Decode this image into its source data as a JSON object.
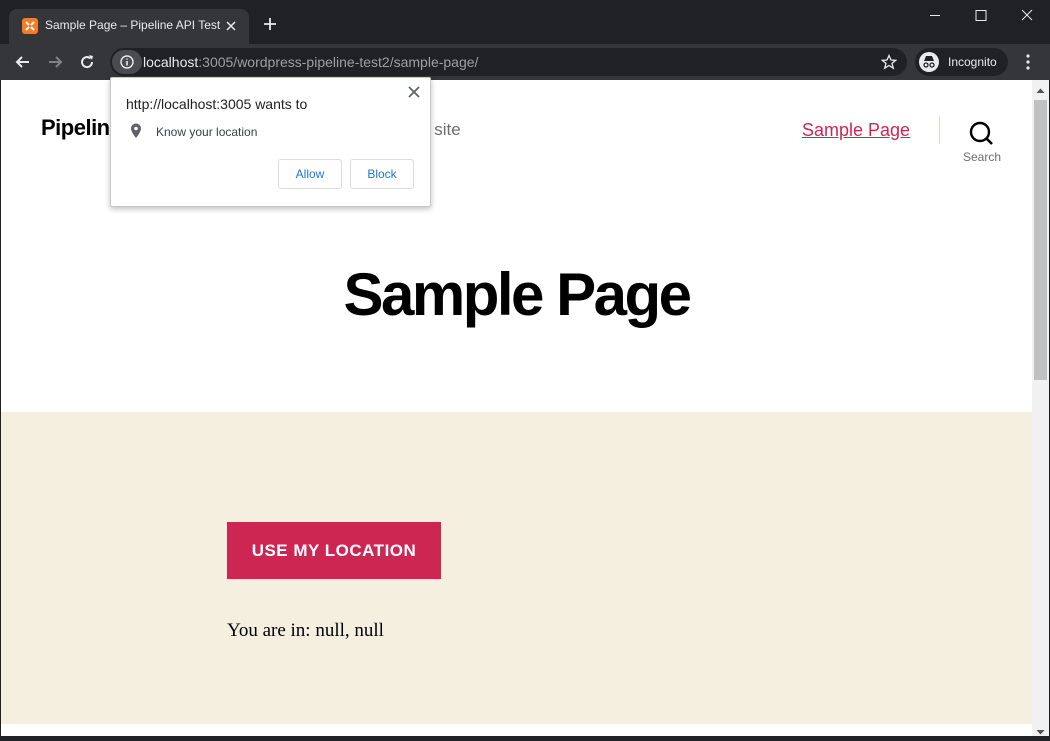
{
  "browser": {
    "tab_title": "Sample Page – Pipeline API Test",
    "url_host": "localhost",
    "url_rest": ":3005/wordpress-pipeline-test2/sample-page/",
    "incognito_label": "Incognito"
  },
  "site": {
    "title": "Pipelin",
    "tagline": "s site",
    "menu": [
      "Sample Page"
    ],
    "search_label": "Search"
  },
  "page": {
    "title": "Sample Page",
    "button_label": "USE MY LOCATION",
    "location_text": "You are in: null, null"
  },
  "permission_popup": {
    "heading": "http://localhost:3005 wants to",
    "permission": "Know your location",
    "allow_label": "Allow",
    "block_label": "Block"
  },
  "colors": {
    "accent": "#cd2653",
    "band_background": "#f5efe0",
    "chrome_dark": "#202124",
    "chrome_toolbar": "#35363a",
    "link_blue": "#1a73e8"
  }
}
